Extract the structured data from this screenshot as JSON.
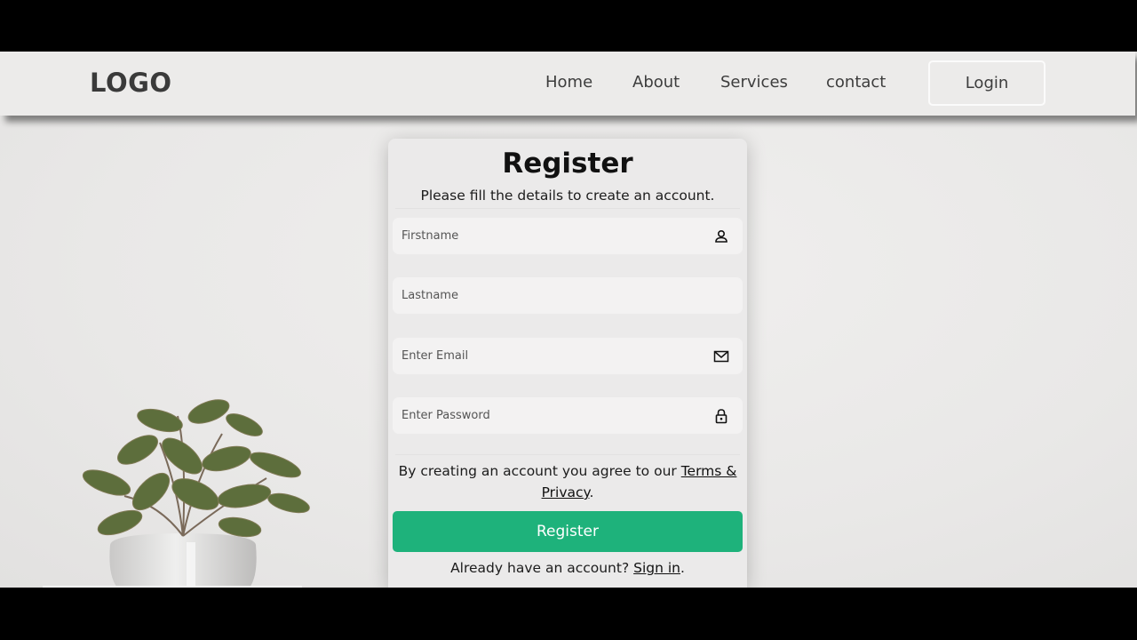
{
  "header": {
    "logo": "LOGO",
    "nav": [
      "Home",
      "About",
      "Services",
      "contact"
    ],
    "login_label": "Login"
  },
  "form": {
    "title": "Register",
    "subtitle": "Please fill the details to create an account.",
    "fields": {
      "firstname": {
        "placeholder": "Firstname",
        "icon": "user-icon"
      },
      "lastname": {
        "placeholder": "Lastname"
      },
      "email": {
        "placeholder": "Enter Email",
        "icon": "mail-icon"
      },
      "password": {
        "placeholder": "Enter Password",
        "icon": "lock-icon"
      }
    },
    "terms_prefix": "By creating an account you agree to our ",
    "terms_link": "Terms & Privacy",
    "terms_suffix": ".",
    "register_label": "Register",
    "signin_prefix": "Already have an account? ",
    "signin_link": "Sign in",
    "signin_suffix": "."
  },
  "colors": {
    "accent": "#1eb27b",
    "background": "#e9e8e7",
    "text": "#1c1c1c"
  }
}
